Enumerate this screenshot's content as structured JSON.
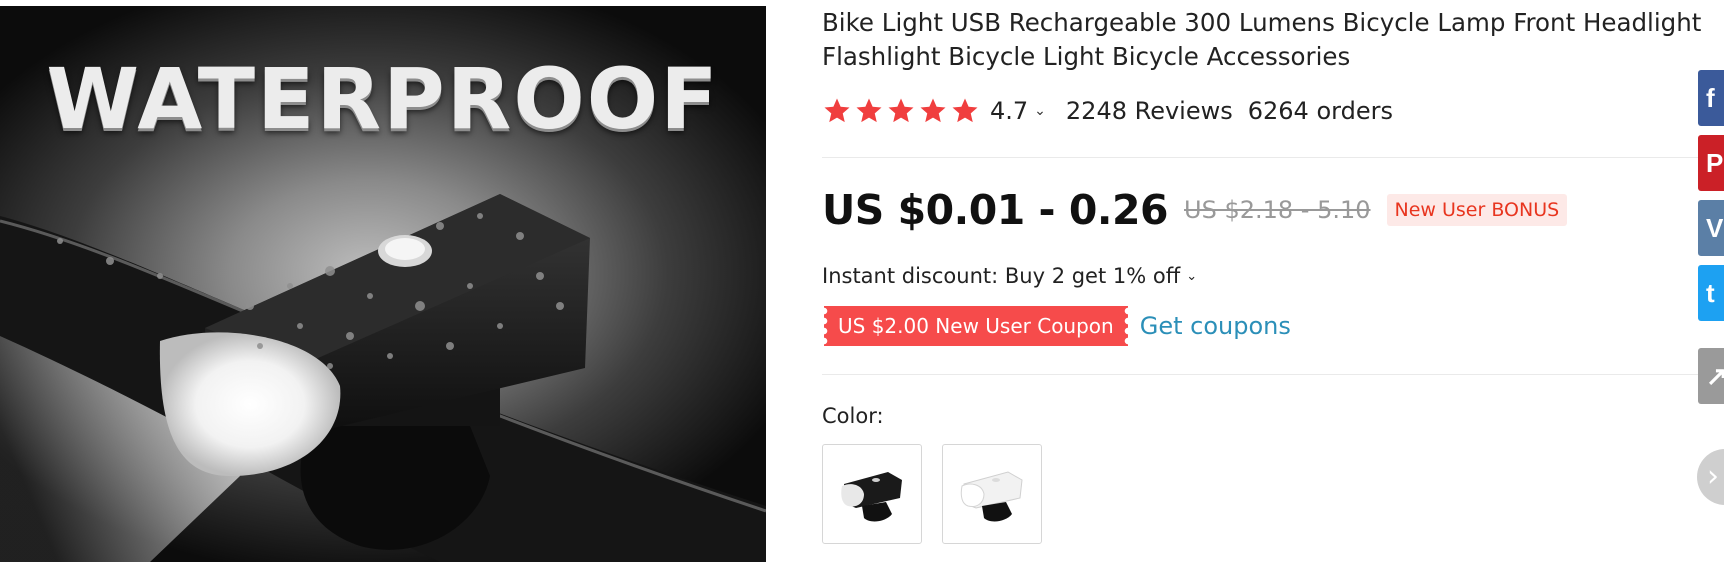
{
  "product_image": {
    "overlay_text": "WATERPROOF"
  },
  "product": {
    "title": "Bike Light USB Rechargeable 300 Lumens Bicycle Lamp Front Headlight Flashlight Bicycle Light Bicycle Accessories",
    "rating": "4.7",
    "rating_stars": 5,
    "reviews": "2248 Reviews",
    "orders": "6264 orders",
    "price": "US $0.01 - 0.26",
    "original_price": "US $2.18 - 5.10",
    "badge": "New User BONUS",
    "discount": "Instant discount: Buy 2 get 1% off",
    "coupon": "US $2.00 New User Coupon",
    "get_coupons": "Get coupons",
    "color_label": "Color:",
    "color_options": [
      {
        "name": "black"
      },
      {
        "name": "white"
      }
    ]
  },
  "colors": {
    "star": "#f03e3e",
    "price": "#111111",
    "badge_text": "#e8351f",
    "badge_bg": "#fde9e7",
    "coupon_bg": "#f64b4b",
    "link": "#2b8fb8"
  },
  "share": [
    {
      "name": "facebook",
      "icon": "facebook-icon",
      "glyph": "f"
    },
    {
      "name": "pinterest",
      "icon": "pinterest-icon",
      "glyph": "P"
    },
    {
      "name": "vk",
      "icon": "vk-icon",
      "glyph": "V"
    },
    {
      "name": "twitter",
      "icon": "twitter-icon",
      "glyph": "t"
    },
    {
      "name": "more",
      "icon": "share-icon",
      "glyph": "↗"
    }
  ]
}
